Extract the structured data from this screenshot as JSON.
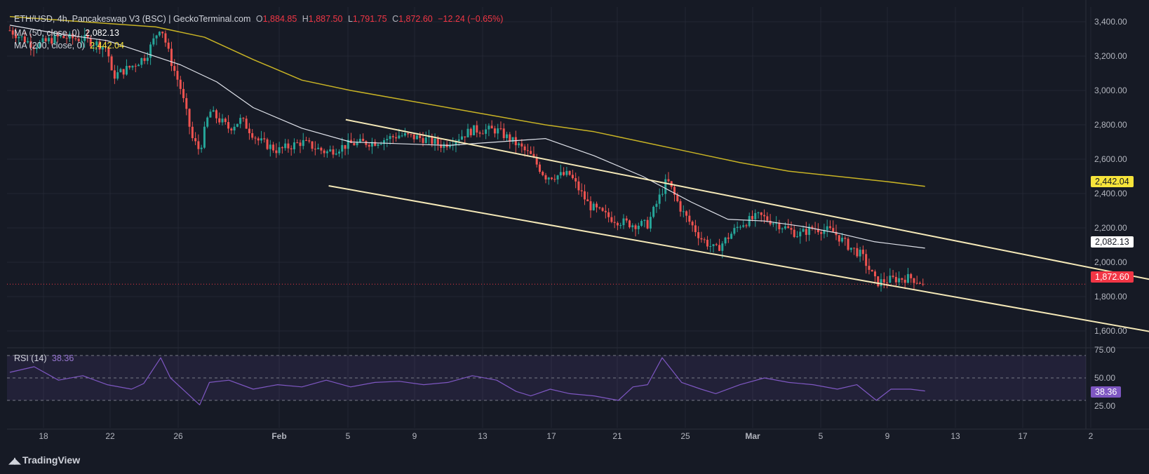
{
  "header": {
    "symbol": "ETH/USD, 4h, Pancakeswap V3 (BSC) | GeckoTerminal.com",
    "o_label": "O",
    "o_value": "1,884.85",
    "h_label": "H",
    "h_value": "1,887.50",
    "l_label": "L",
    "l_value": "1,791.75",
    "c_label": "C",
    "c_value": "1,872.60",
    "change": "−12.24 (−0.65%)"
  },
  "indicators": {
    "ma50_label": "MA (50, close, 0)",
    "ma50_value": "2,082.13",
    "ma200_label": "MA (200, close, 0)",
    "ma200_value": "2,442.04",
    "rsi_label": "RSI (14)",
    "rsi_value": "38.36"
  },
  "price_pills": {
    "ma200": "2,442.04",
    "ma50": "2,082.13",
    "last": "1,872.60",
    "rsi": "38.36"
  },
  "colors": {
    "background": "#161a25",
    "grid": "#232734",
    "up": "#26a69a",
    "down": "#ef5350",
    "ma50": "#e0e3eb",
    "ma200": "#c8b325",
    "channel": "#f5e9b8",
    "rsi": "#7e57c2",
    "last_price": "#f23645"
  },
  "logo": {
    "text": "TradingView"
  },
  "chart_data": {
    "type": "candlestick",
    "price_axis": {
      "ticks": [
        "3,400.00",
        "3,200.00",
        "3,000.00",
        "2,800.00",
        "2,600.00",
        "2,400.00",
        "2,200.00",
        "2,000.00",
        "1,800.00",
        "1,600.00"
      ],
      "tick_values": [
        3400,
        3200,
        3000,
        2800,
        2600,
        2400,
        2200,
        2000,
        1800,
        1600
      ]
    },
    "rsi_axis": {
      "ticks": [
        "75.00",
        "50.00",
        "25.00"
      ],
      "tick_values": [
        75,
        50,
        25
      ],
      "band": [
        30,
        70
      ]
    },
    "time_axis": {
      "labels": [
        "18",
        "22",
        "26",
        "Feb",
        "5",
        "9",
        "13",
        "17",
        "21",
        "25",
        "Mar",
        "5",
        "9",
        "13",
        "17",
        "2"
      ],
      "bold": [
        "Feb",
        "Mar"
      ]
    },
    "last_price": 1872.6,
    "ma50_last": 2082.13,
    "ma200_last": 2442.04,
    "rsi_last": 38.36,
    "channel": {
      "upper": [
        [
          1.38,
          2830
        ],
        [
          4.79,
          1870
        ]
      ],
      "lower": [
        [
          1.31,
          2445
        ],
        [
          4.77,
          1575
        ]
      ]
    },
    "close_path": [
      [
        0.0,
        3350
      ],
      [
        0.1,
        3260
      ],
      [
        0.2,
        3310
      ],
      [
        0.3,
        3300
      ],
      [
        0.4,
        3250
      ],
      [
        0.42,
        3080
      ],
      [
        0.5,
        3140
      ],
      [
        0.56,
        3200
      ],
      [
        0.62,
        3380
      ],
      [
        0.66,
        3180
      ],
      [
        0.7,
        3020
      ],
      [
        0.75,
        2720
      ],
      [
        0.78,
        2650
      ],
      [
        0.82,
        2880
      ],
      [
        0.9,
        2780
      ],
      [
        0.95,
        2830
      ],
      [
        1.02,
        2710
      ],
      [
        1.1,
        2650
      ],
      [
        1.2,
        2700
      ],
      [
        1.3,
        2640
      ],
      [
        1.4,
        2690
      ],
      [
        1.5,
        2700
      ],
      [
        1.6,
        2740
      ],
      [
        1.7,
        2720
      ],
      [
        1.78,
        2680
      ],
      [
        1.9,
        2770
      ],
      [
        2.0,
        2770
      ],
      [
        2.08,
        2690
      ],
      [
        2.14,
        2620
      ],
      [
        2.2,
        2500
      ],
      [
        2.3,
        2510
      ],
      [
        2.38,
        2330
      ],
      [
        2.45,
        2270
      ],
      [
        2.5,
        2240
      ],
      [
        2.56,
        2220
      ],
      [
        2.62,
        2220
      ],
      [
        2.7,
        2480
      ],
      [
        2.76,
        2300
      ],
      [
        2.84,
        2140
      ],
      [
        2.9,
        2070
      ],
      [
        3.0,
        2220
      ],
      [
        3.08,
        2270
      ],
      [
        3.16,
        2220
      ],
      [
        3.24,
        2160
      ],
      [
        3.3,
        2200
      ],
      [
        3.38,
        2180
      ],
      [
        3.44,
        2100
      ],
      [
        3.5,
        2040
      ],
      [
        3.56,
        1880
      ],
      [
        3.62,
        1900
      ],
      [
        3.7,
        1910
      ],
      [
        3.76,
        1872.6
      ]
    ],
    "ma50_path": [
      [
        0.0,
        3380
      ],
      [
        0.2,
        3330
      ],
      [
        0.4,
        3290
      ],
      [
        0.55,
        3220
      ],
      [
        0.7,
        3150
      ],
      [
        0.85,
        3050
      ],
      [
        1.0,
        2900
      ],
      [
        1.2,
        2780
      ],
      [
        1.4,
        2700
      ],
      [
        1.6,
        2690
      ],
      [
        1.8,
        2680
      ],
      [
        2.0,
        2700
      ],
      [
        2.2,
        2720
      ],
      [
        2.4,
        2620
      ],
      [
        2.6,
        2500
      ],
      [
        2.8,
        2350
      ],
      [
        2.95,
        2250
      ],
      [
        3.1,
        2240
      ],
      [
        3.25,
        2210
      ],
      [
        3.4,
        2170
      ],
      [
        3.55,
        2120
      ],
      [
        3.76,
        2082.13
      ]
    ],
    "ma200_path": [
      [
        0.0,
        3430
      ],
      [
        0.3,
        3400
      ],
      [
        0.6,
        3370
      ],
      [
        0.8,
        3310
      ],
      [
        1.0,
        3180
      ],
      [
        1.2,
        3060
      ],
      [
        1.4,
        3000
      ],
      [
        1.6,
        2950
      ],
      [
        1.8,
        2900
      ],
      [
        2.0,
        2850
      ],
      [
        2.2,
        2800
      ],
      [
        2.4,
        2760
      ],
      [
        2.6,
        2700
      ],
      [
        2.8,
        2640
      ],
      [
        3.0,
        2580
      ],
      [
        3.2,
        2530
      ],
      [
        3.4,
        2500
      ],
      [
        3.6,
        2470
      ],
      [
        3.76,
        2442.04
      ]
    ],
    "rsi_path": [
      [
        0.0,
        55
      ],
      [
        0.1,
        60
      ],
      [
        0.2,
        48
      ],
      [
        0.3,
        52
      ],
      [
        0.4,
        44
      ],
      [
        0.5,
        40
      ],
      [
        0.55,
        45
      ],
      [
        0.62,
        68
      ],
      [
        0.66,
        50
      ],
      [
        0.72,
        38
      ],
      [
        0.78,
        26
      ],
      [
        0.82,
        46
      ],
      [
        0.9,
        48
      ],
      [
        1.0,
        40
      ],
      [
        1.1,
        44
      ],
      [
        1.2,
        42
      ],
      [
        1.3,
        48
      ],
      [
        1.4,
        42
      ],
      [
        1.5,
        46
      ],
      [
        1.6,
        47
      ],
      [
        1.7,
        44
      ],
      [
        1.8,
        46
      ],
      [
        1.9,
        52
      ],
      [
        2.0,
        48
      ],
      [
        2.08,
        38
      ],
      [
        2.14,
        34
      ],
      [
        2.22,
        40
      ],
      [
        2.3,
        36
      ],
      [
        2.4,
        34
      ],
      [
        2.5,
        30
      ],
      [
        2.56,
        42
      ],
      [
        2.62,
        44
      ],
      [
        2.68,
        68
      ],
      [
        2.76,
        46
      ],
      [
        2.84,
        40
      ],
      [
        2.9,
        36
      ],
      [
        3.0,
        44
      ],
      [
        3.1,
        50
      ],
      [
        3.2,
        46
      ],
      [
        3.3,
        44
      ],
      [
        3.4,
        40
      ],
      [
        3.48,
        44
      ],
      [
        3.56,
        30
      ],
      [
        3.62,
        40
      ],
      [
        3.7,
        40
      ],
      [
        3.76,
        38.36
      ]
    ]
  }
}
